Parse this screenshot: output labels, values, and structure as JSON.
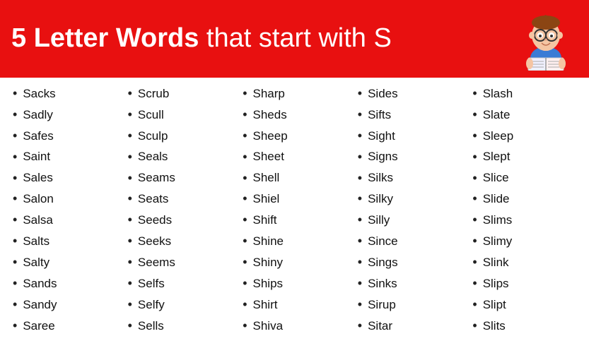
{
  "header": {
    "title_bold": "5 Letter Words",
    "title_normal": " that start with S"
  },
  "columns": [
    {
      "id": "col1",
      "words": [
        "Sacks",
        "Sadly",
        "Safes",
        "Saint",
        "Sales",
        "Salon",
        "Salsa",
        "Salts",
        "Salty",
        "Sands",
        "Sandy",
        "Saree"
      ]
    },
    {
      "id": "col2",
      "words": [
        "Scrub",
        "Scull",
        "Sculp",
        "Seals",
        "Seams",
        "Seats",
        "Seeds",
        "Seeks",
        "Seems",
        "Selfs",
        "Selfy",
        "Sells"
      ]
    },
    {
      "id": "col3",
      "words": [
        "Sharp",
        "Sheds",
        "Sheep",
        "Sheet",
        "Shell",
        "Shiel",
        "Shift",
        "Shine",
        "Shiny",
        "Ships",
        "Shirt",
        "Shiva"
      ]
    },
    {
      "id": "col4",
      "words": [
        "Sides",
        "Sifts",
        "Sight",
        "Signs",
        "Silks",
        "Silky",
        "Silly",
        "Since",
        "Sings",
        "Sinks",
        "Sirup",
        "Sitar"
      ]
    },
    {
      "id": "col5",
      "words": [
        "Slash",
        "Slate",
        "Sleep",
        "Slept",
        "Slice",
        "Slide",
        "Slims",
        "Slimy",
        "Slink",
        "Slips",
        "Slipt",
        "Slits"
      ]
    }
  ],
  "bullet": "•"
}
